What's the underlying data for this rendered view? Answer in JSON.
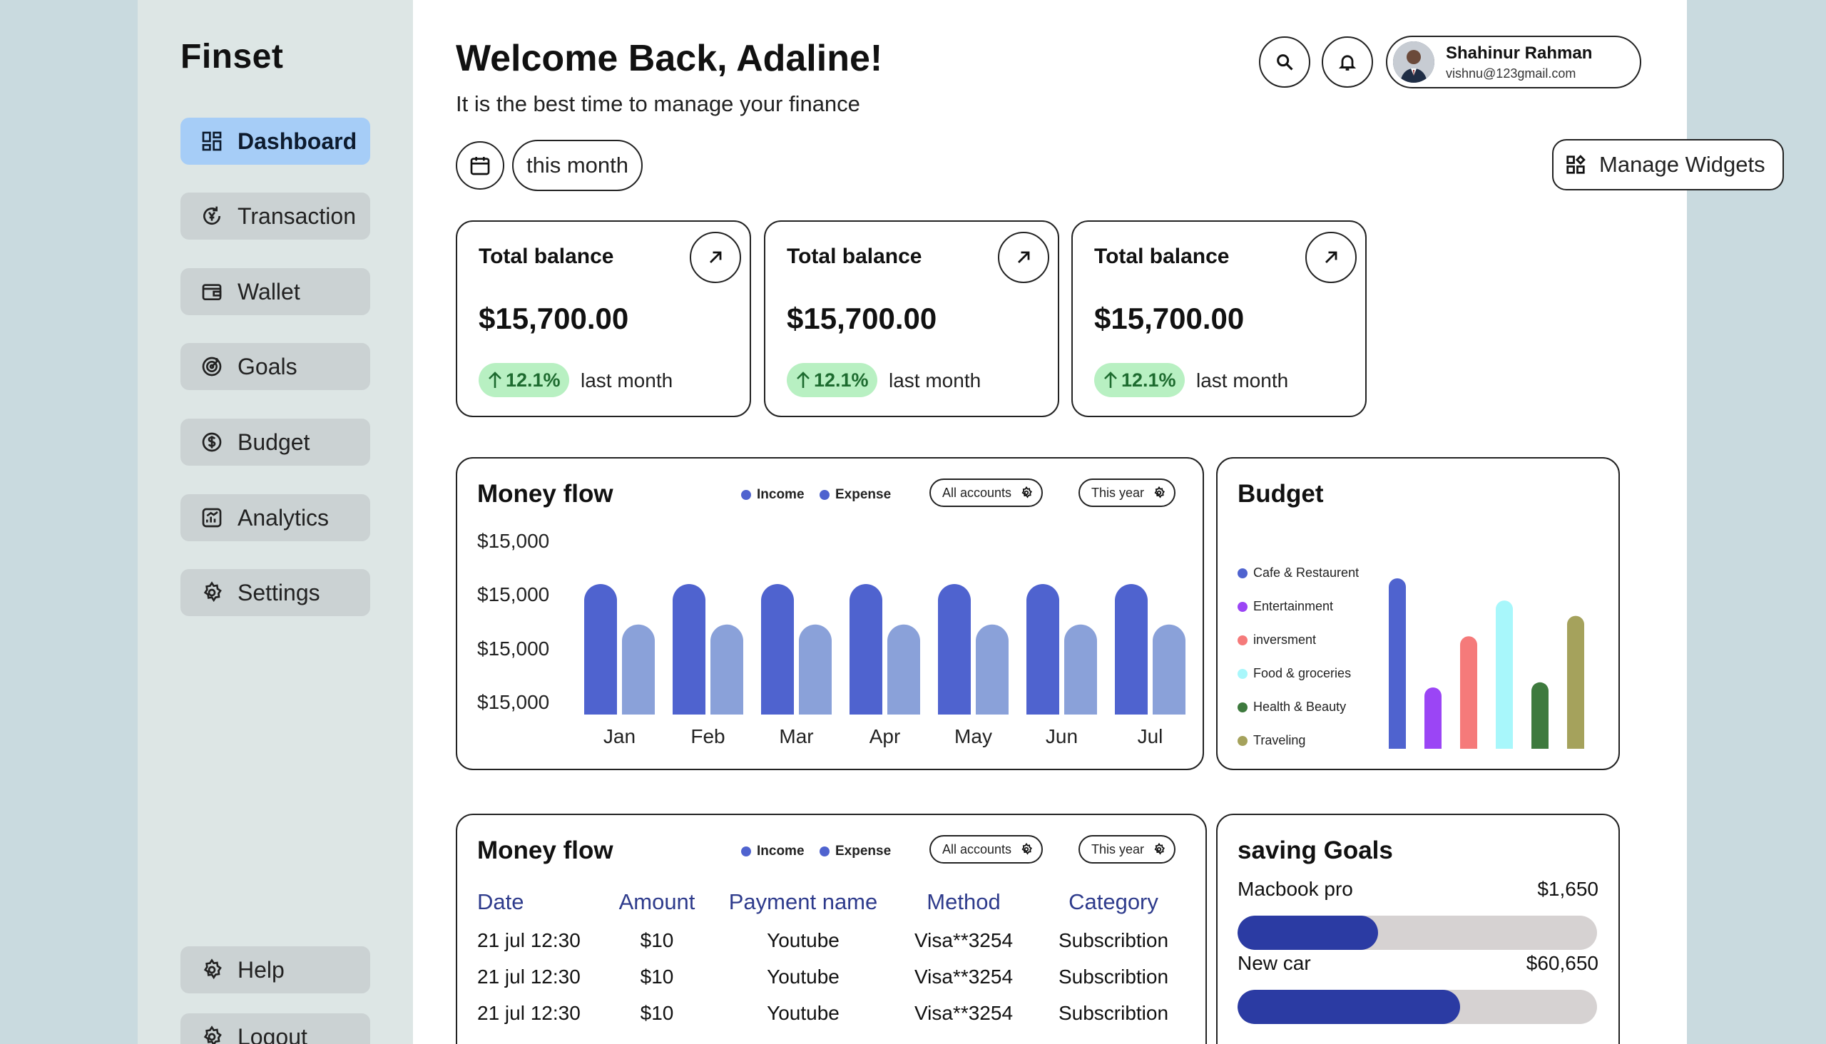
{
  "brand": "Finset",
  "sidebar": {
    "items": [
      {
        "label": "Dashboard",
        "icon": "dashboard-icon",
        "active": true
      },
      {
        "label": "Transaction",
        "icon": "transaction-icon"
      },
      {
        "label": "Wallet",
        "icon": "wallet-icon"
      },
      {
        "label": "Goals",
        "icon": "goals-icon"
      },
      {
        "label": "Budget",
        "icon": "budget-icon"
      },
      {
        "label": "Analytics",
        "icon": "analytics-icon"
      },
      {
        "label": "Settings",
        "icon": "settings-icon"
      }
    ],
    "bottom": [
      {
        "label": "Help",
        "icon": "help-icon"
      },
      {
        "label": "Logout",
        "icon": "logout-icon"
      }
    ]
  },
  "header": {
    "title": "Welcome Back, Adaline!",
    "subtitle": "It is the best time to manage your finance",
    "user": {
      "name": "Shahinur Rahman",
      "email": "vishnu@123gmail.com"
    },
    "period": "this month",
    "manage_widgets": "Manage Widgets"
  },
  "cards": [
    {
      "title": "Total balance",
      "amount": "$15,700.00",
      "change": "12.1%",
      "note": "last month"
    },
    {
      "title": "Total balance",
      "amount": "$15,700.00",
      "change": "12.1%",
      "note": "last month"
    },
    {
      "title": "Total balance",
      "amount": "$15,700.00",
      "change": "12.1%",
      "note": "last month"
    }
  ],
  "money_flow": {
    "title": "Money flow",
    "legend": [
      {
        "label": "Income",
        "color": "#4f63cf"
      },
      {
        "label": "Expense",
        "color": "#4f63cf"
      }
    ],
    "accounts_filter": "All accounts",
    "period_filter": "This year",
    "y_ticks": [
      "$15,000",
      "$15,000",
      "$15,000",
      "$15,000"
    ]
  },
  "chart_data": [
    {
      "type": "bar",
      "title": "Money flow",
      "categories": [
        "Jan",
        "Feb",
        "Mar",
        "Apr",
        "May",
        "Jun",
        "Jul"
      ],
      "series": [
        {
          "name": "Income",
          "color": "#4f63cf",
          "values": [
            1.0,
            1.0,
            1.0,
            1.0,
            1.0,
            1.0,
            1.0
          ]
        },
        {
          "name": "Expense",
          "color": "#8aa1d9",
          "values": [
            0.69,
            0.69,
            0.69,
            0.69,
            0.69,
            0.69,
            0.69
          ]
        }
      ],
      "y_tick_labels": [
        "$15,000",
        "$15,000",
        "$15,000",
        "$15,000"
      ],
      "grid": false
    },
    {
      "type": "bar",
      "title": "Budget",
      "categories": [
        "Cafe & Restaurent",
        "Entertainment",
        "inversment",
        "Food & groceries",
        "Health & Beauty",
        "Traveling"
      ],
      "values": [
        1.0,
        0.36,
        0.66,
        0.87,
        0.39,
        0.78
      ],
      "colors": [
        "#4f63cf",
        "#9b45f5",
        "#f57a7a",
        "#a8f7fb",
        "#3e7a3e",
        "#a5a25c"
      ],
      "legend": "left"
    }
  ],
  "budget": {
    "title": "Budget"
  },
  "transactions": {
    "title": "Money flow",
    "legend": [
      {
        "label": "Income",
        "color": "#4f63cf"
      },
      {
        "label": "Expense",
        "color": "#4f63cf"
      }
    ],
    "accounts_filter": "All accounts",
    "period_filter": "This year",
    "columns": [
      "Date",
      "Amount",
      "Payment name",
      "Method",
      "Category"
    ],
    "rows": [
      [
        "21 jul 12:30",
        "$10",
        "Youtube",
        "Visa**3254",
        "Subscribtion"
      ],
      [
        "21 jul 12:30",
        "$10",
        "Youtube",
        "Visa**3254",
        "Subscribtion"
      ],
      [
        "21 jul 12:30",
        "$10",
        "Youtube",
        "Visa**3254",
        "Subscribtion"
      ]
    ]
  },
  "saving_goals": {
    "title": "saving Goals",
    "goals": [
      {
        "label": "Macbook pro",
        "amount": "$1,650",
        "progress": 0.39
      },
      {
        "label": "New car",
        "amount": "$60,650",
        "progress": 0.62
      }
    ]
  }
}
